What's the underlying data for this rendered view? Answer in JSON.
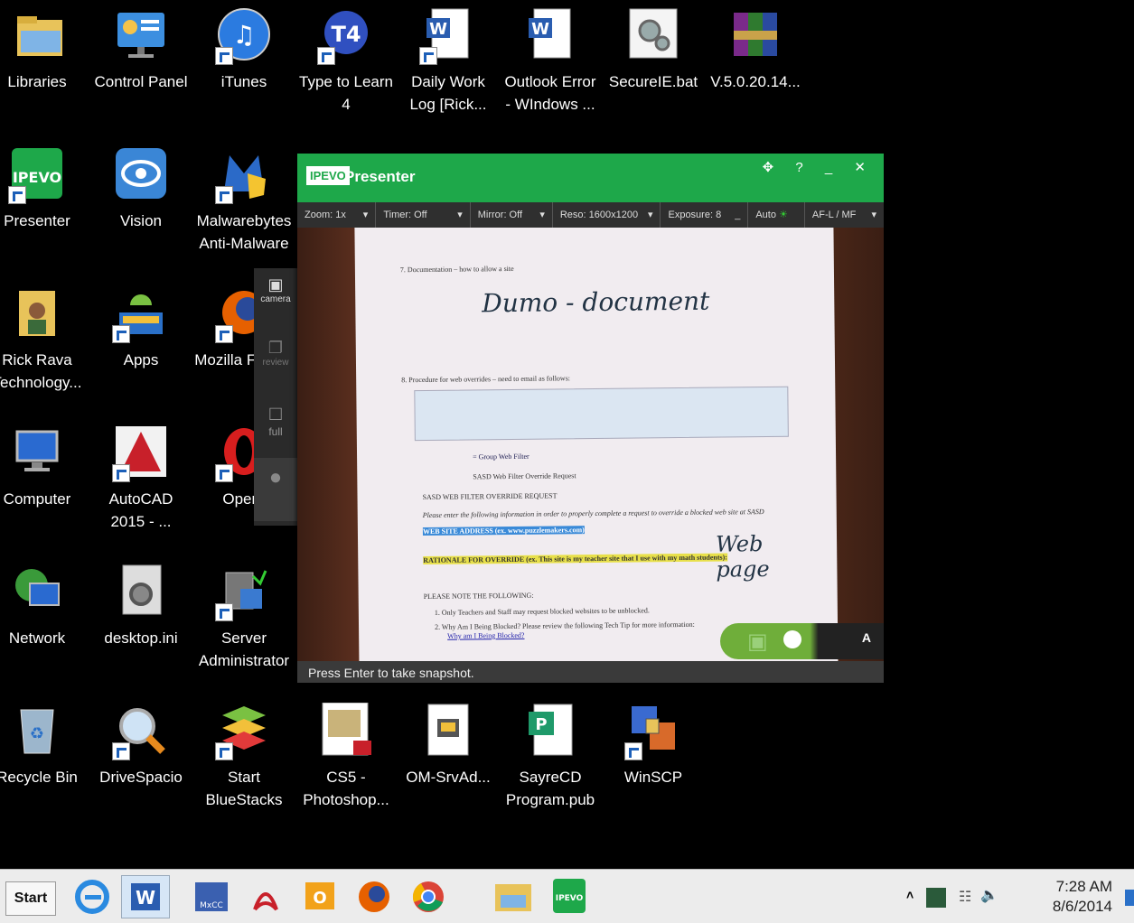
{
  "desktop": {
    "icons": [
      {
        "label": "Libraries"
      },
      {
        "label": "Control Panel"
      },
      {
        "label": "iTunes"
      },
      {
        "label": "Type to Learn 4"
      },
      {
        "label": "Daily Work Log [Rick..."
      },
      {
        "label": "Outlook Error - WIndows ..."
      },
      {
        "label": "SecureIE.bat"
      },
      {
        "label": "V.5.0.20.14..."
      },
      {
        "label": "Presenter"
      },
      {
        "label": "Vision"
      },
      {
        "label": "Malwarebytes Anti-Malware"
      },
      {
        "label": "Rick Rava Technology..."
      },
      {
        "label": "Apps"
      },
      {
        "label": "Mozilla Firefox"
      },
      {
        "label": "Computer"
      },
      {
        "label": "AutoCAD 2015 - ..."
      },
      {
        "label": "Opera"
      },
      {
        "label": "Network"
      },
      {
        "label": "desktop.ini"
      },
      {
        "label": "Server Administrator"
      },
      {
        "label": "Recycle Bin"
      },
      {
        "label": "DriveSpacio"
      },
      {
        "label": "Start BlueStacks"
      },
      {
        "label": "CS5 - Photoshop..."
      },
      {
        "label": "OM-SrvAd..."
      },
      {
        "label": "SayreCD Program.pub"
      },
      {
        "label": "WinSCP"
      }
    ]
  },
  "presenter": {
    "logo": "IPEVO",
    "title": "Presenter",
    "controls": "✥ ? _ ✕",
    "toolbar": {
      "zoom": "Zoom: 1x",
      "timer": "Timer: Off",
      "mirror": "Mirror: Off",
      "reso": "Reso: 1600x1200",
      "exposure": "Exposure: 8",
      "auto": "Auto",
      "focus": "AF-L / MF"
    },
    "side": {
      "camera": "camera",
      "review": "review",
      "full": "full"
    },
    "status": "Press Enter to take snapshot.",
    "snapshot_label": "A",
    "doc": {
      "line7": "7.   Documentation – how to allow a site",
      "hand1": "Dumo - document",
      "line8": "8.   Procedure for web overrides – need to email as follows:",
      "to": "= Group Web Filter",
      "subject": "SASD Web Filter Override Request",
      "header": "SASD WEB FILTER OVERRIDE REQUEST",
      "instr": "Please enter the following information in order to properly complete a request to override a blocked web site at SASD",
      "website": "WEB SITE ADDRESS (ex. www.puzzlemakers.com)",
      "rationale": "RATIONALE FOR OVERRIDE (ex. This site is my teacher site that I use with my math students):",
      "hand2": "Web page",
      "note": "PLEASE NOTE THE FOLLOWING:",
      "n1": "1.  Only Teachers and Staff may request blocked websites to be unblocked.",
      "n2": "2.  Why Am I Being Blocked? Please review the following Tech Tip for more information:",
      "link": "Why am I Being Blocked?"
    }
  },
  "taskbar": {
    "start": "Start",
    "clock_time": "7:28 AM",
    "clock_date": "8/6/2014",
    "tray_up": "˄"
  },
  "colors": {
    "presenter_green": "#1ea84a"
  }
}
